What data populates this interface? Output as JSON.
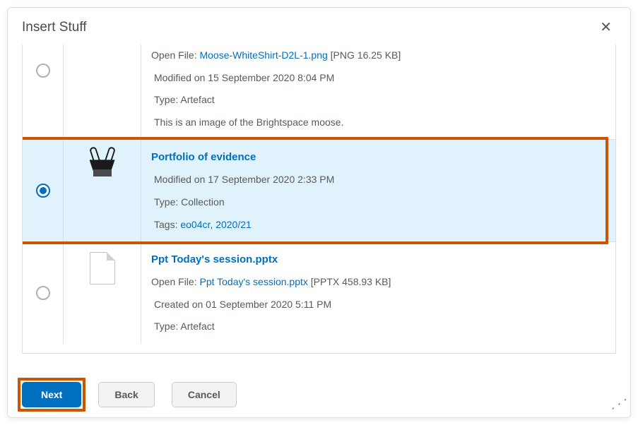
{
  "modal": {
    "title": "Insert Stuff"
  },
  "items": [
    {
      "open_label": "Open File:",
      "filename": "Moose-WhiteShirt-D2L-1.png",
      "fileinfo": "[PNG  16.25 KB]",
      "modified": "Modified on 15 September 2020 8:04 PM",
      "type_label": "Type:",
      "type_value": "Artefact",
      "description": "This is an image of the Brightspace moose."
    },
    {
      "title": "Portfolio of evidence",
      "modified": "Modified on 17 September 2020 2:33 PM",
      "type_label": "Type:",
      "type_value": "Collection",
      "tags_label": "Tags:",
      "tag1": "eo04cr",
      "tag_sep": ",",
      "tag2": "2020/21"
    },
    {
      "title": "Ppt Today's session.pptx",
      "open_label": "Open File:",
      "filename": "Ppt Today's session.pptx",
      "fileinfo": "[PPTX  458.93 KB]",
      "created": "Created on 01 September 2020 5:11 PM",
      "type_label": "Type:",
      "type_value": "Artefact"
    }
  ],
  "footer": {
    "next": "Next",
    "back": "Back",
    "cancel": "Cancel"
  }
}
